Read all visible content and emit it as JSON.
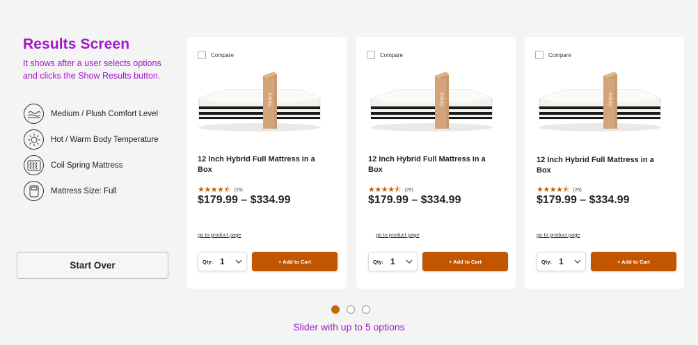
{
  "sidebar": {
    "title": "Results Screen",
    "subtitle": "It shows after a user selects options and clicks the Show Results button.",
    "attributes": [
      {
        "icon": "comfort-level-icon",
        "label": "Medium / Plush Comfort Level"
      },
      {
        "icon": "temperature-sun-icon",
        "label": "Hot / Warm Body Temperature"
      },
      {
        "icon": "coil-spring-icon",
        "label": "Coil Spring Mattress"
      },
      {
        "icon": "mattress-size-icon",
        "label": "Mattress Size: Full"
      }
    ],
    "start_over_label": "Start Over"
  },
  "products": [
    {
      "compare_label": "Compare",
      "name": "12 Inch Hybrid Full Mattress in a Box",
      "rating": 4.5,
      "stars": "★★★★⯪",
      "review_count": "(25)",
      "price": "$179.99 – $334.99",
      "link_label": "go to product page",
      "qty_label": "Qty:",
      "qty_value": "1",
      "add_to_cart_label": "+ Add to Cart",
      "box_brand": "Ashley"
    },
    {
      "compare_label": "Compare",
      "name": "12 Inch Hybrid Full Mattress in a Box",
      "rating": 4.5,
      "stars": "★★★★⯪",
      "review_count": "(25)",
      "price": "$179.99 – $334.99",
      "link_label": "go to product page",
      "qty_label": "Qty:",
      "qty_value": "1",
      "add_to_cart_label": "+ Add to Cart",
      "box_brand": "Ashley"
    },
    {
      "compare_label": "Compare",
      "name": "12 Inch Hybrid Full Mattress in a Box",
      "rating": 4.5,
      "stars": "★★★★⯪",
      "review_count": "(25)",
      "price": "$179.99 – $334.99",
      "link_label": "go to product page",
      "qty_label": "Qty:",
      "qty_value": "1",
      "add_to_cart_label": "+ Add to Cart",
      "box_brand": "Ashley"
    }
  ],
  "slider": {
    "dots_total": 3,
    "active_index": 0,
    "caption": "Slider with up to 5 options"
  },
  "colors": {
    "accent_purple": "#a316c9",
    "cart_orange": "#c25500",
    "star_orange": "#c55a00",
    "background": "#f4f4f4"
  }
}
